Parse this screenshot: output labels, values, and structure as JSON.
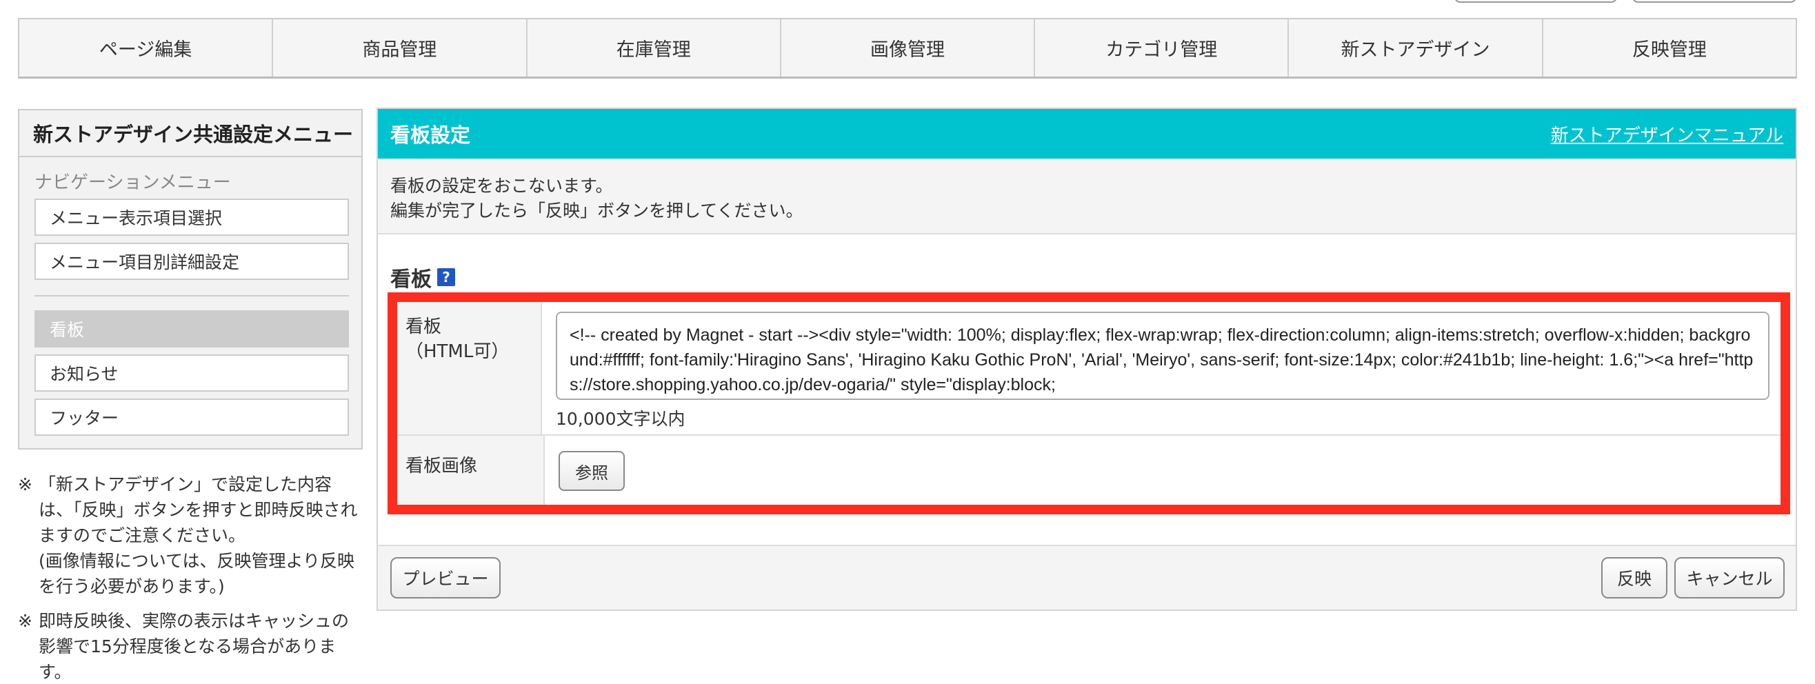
{
  "nav": {
    "tabs": [
      "ページ編集",
      "商品管理",
      "在庫管理",
      "画像管理",
      "カテゴリ管理",
      "新ストアデザイン",
      "反映管理"
    ]
  },
  "sidebar": {
    "title": "新ストアデザイン共通設定メニュー",
    "nav_heading": "ナビゲーションメニュー",
    "items": [
      {
        "label": "メニュー表示項目選択"
      },
      {
        "label": "メニュー項目別詳細設定"
      },
      {
        "label": "看板"
      },
      {
        "label": "お知らせ"
      },
      {
        "label": "フッター"
      }
    ]
  },
  "notes": {
    "mark": "※",
    "note1_lines": [
      "「新ストアデザイン」で設定した内容は、「反映」ボタンを押すと即時反映されますのでご注意ください。",
      "(画像情報については、反映管理より反映を行う必要があります。)"
    ],
    "note2": "即時反映後、実際の表示はキャッシュの影響で15分程度後となる場合があります。"
  },
  "main": {
    "title": "看板設定",
    "manual_link": "新ストアデザインマニュアル",
    "desc_line1": "看板の設定をおこないます。",
    "desc_line2": "編集が完了したら「反映」ボタンを押してください。",
    "section_title": "看板",
    "help_icon": "?",
    "row1_label_line1": "看板",
    "row1_label_line2": "（HTML可）",
    "textarea_value": "<!-- created by Magnet - start --><div style=\"width: 100%; display:flex; flex-wrap:wrap; flex-direction:column; align-items:stretch; overflow-x:hidden; background:#ffffff; font-family:'Hiragino Sans', 'Hiragino Kaku Gothic ProN', 'Arial', 'Meiryo', sans-serif; font-size:14px; color:#241b1b; line-height: 1.6;\"><a href=\"https://store.shopping.yahoo.co.jp/dev-ogaria/\" style=\"display:block;",
    "limit_text": "10,000文字以内",
    "row2_label": "看板画像",
    "browse_label": "参照"
  },
  "footer": {
    "preview_label": "プレビュー",
    "apply_label": "反映",
    "cancel_label": "キャンセル"
  },
  "colors": {
    "header_bg": "#00c3cf",
    "highlight": "#fd2d1f",
    "help_icon": "#1f55c5"
  }
}
